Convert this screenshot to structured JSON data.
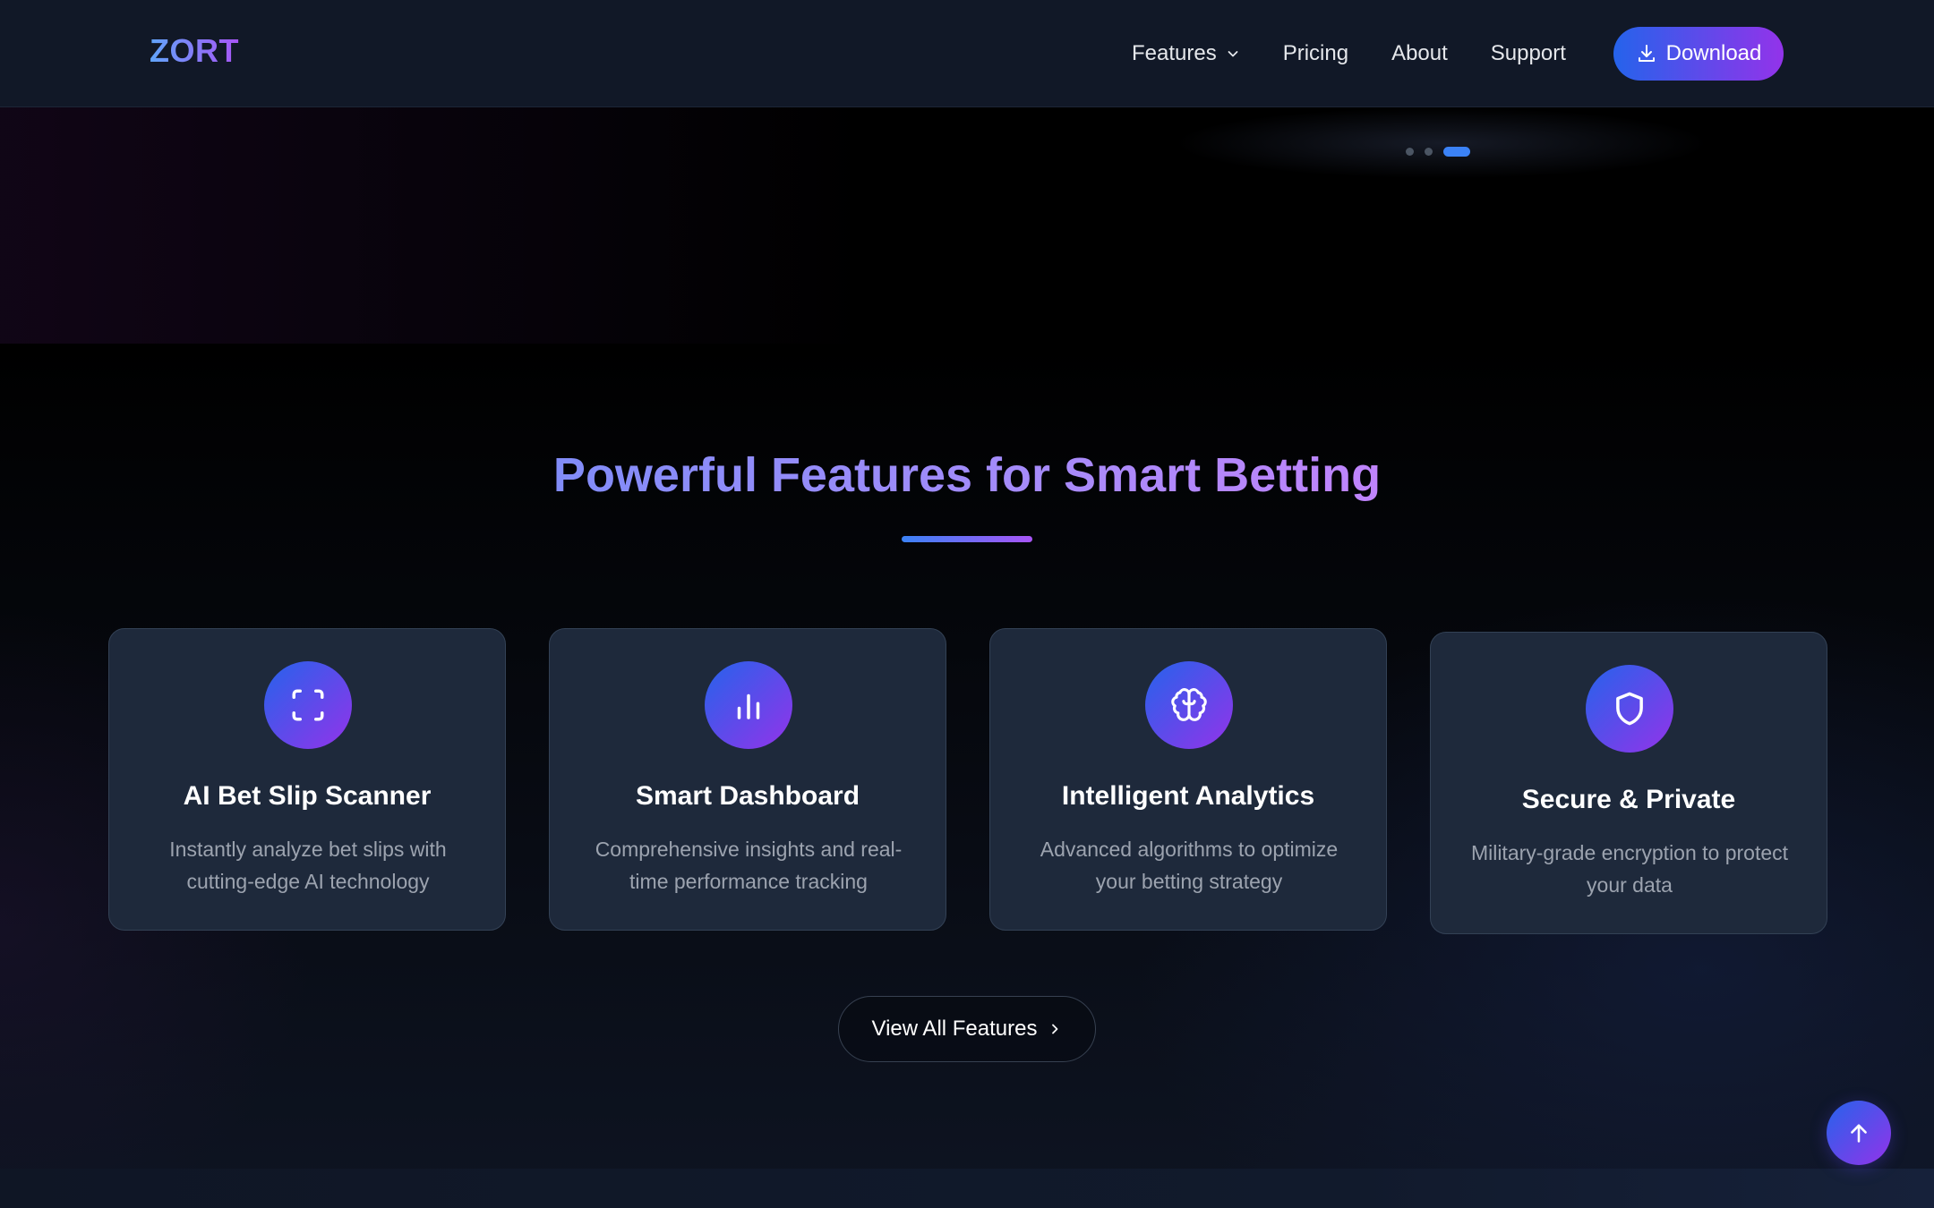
{
  "header": {
    "logo": "ZORT",
    "nav": [
      {
        "label": "Features",
        "icon": "chevron-down-icon"
      },
      {
        "label": "Pricing"
      },
      {
        "label": "About"
      },
      {
        "label": "Support"
      }
    ],
    "download_label": "Download",
    "download_icon": "download-icon"
  },
  "hero": {
    "carousel_count": 3,
    "active_index": 2
  },
  "features": {
    "title": "Powerful Features for Smart Betting",
    "cards": [
      {
        "icon": "scan-icon",
        "title": "AI Bet Slip Scanner",
        "description": "Instantly analyze bet slips with cutting-edge AI technology"
      },
      {
        "icon": "bar-chart-icon",
        "title": "Smart Dashboard",
        "description": "Comprehensive insights and real-time performance tracking"
      },
      {
        "icon": "brain-icon",
        "title": "Intelligent Analytics",
        "description": "Advanced algorithms to optimize your betting strategy"
      },
      {
        "icon": "shield-icon",
        "title": "Secure & Private",
        "description": "Military-grade encryption to protect your data"
      }
    ],
    "view_all_label": "View All Features",
    "view_all_icon": "chevron-right-icon"
  },
  "scroll_top_icon": "arrow-up-icon",
  "colors": {
    "accent_blue": "#2563eb",
    "accent_purple": "#9333ea",
    "card_bg": "#1e293b",
    "header_bg": "#111827"
  }
}
